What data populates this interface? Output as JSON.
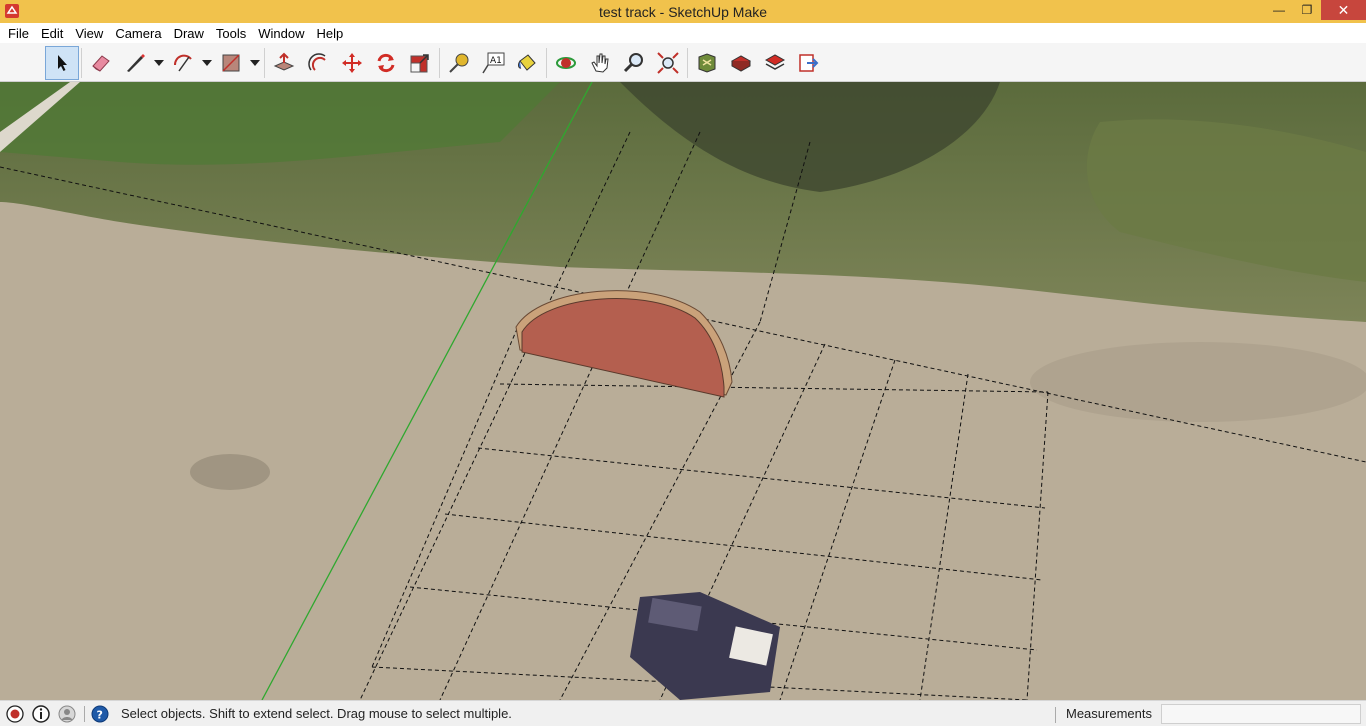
{
  "window": {
    "title": "test track - SketchUp Make",
    "minimize_glyph": "—",
    "restore_glyph": "❐",
    "close_glyph": "✕"
  },
  "menu": [
    {
      "label": "File"
    },
    {
      "label": "Edit"
    },
    {
      "label": "View"
    },
    {
      "label": "Camera"
    },
    {
      "label": "Draw"
    },
    {
      "label": "Tools"
    },
    {
      "label": "Window"
    },
    {
      "label": "Help"
    }
  ],
  "toolbar": {
    "tools": [
      {
        "icon": "select-arrow-icon",
        "active": true
      },
      {
        "icon": "eraser-icon"
      },
      {
        "icon": "pencil-line-icon",
        "dropdown": true
      },
      {
        "icon": "arc-icon",
        "dropdown": true
      },
      {
        "icon": "rectangle-icon",
        "dropdown": true
      },
      {
        "icon": "push-pull-icon"
      },
      {
        "icon": "offset-icon"
      },
      {
        "icon": "move-icon"
      },
      {
        "icon": "rotate-icon"
      },
      {
        "icon": "scale-icon"
      },
      {
        "icon": "tape-measure-icon"
      },
      {
        "icon": "text-label-icon"
      },
      {
        "icon": "paint-bucket-icon"
      },
      {
        "icon": "orbit-icon"
      },
      {
        "icon": "pan-hand-icon"
      },
      {
        "icon": "zoom-icon"
      },
      {
        "icon": "zoom-extents-icon"
      },
      {
        "icon": "3d-warehouse-icon"
      },
      {
        "icon": "extension-warehouse-icon"
      },
      {
        "icon": "layout-send-icon"
      },
      {
        "icon": "share-model-icon"
      }
    ],
    "text_tool_glyph": "A1"
  },
  "status": {
    "message": "Select objects. Shift to extend select. Drag mouse to select multiple.",
    "measurements_label": "Measurements",
    "measurements_value": ""
  },
  "colors": {
    "titlebar": "#f1c24c",
    "close_button": "#c7463d",
    "model_face": "#b45f4f",
    "model_edge": "#caa27a",
    "green_axis": "#2fa82f",
    "ground": "#b9ad98"
  }
}
